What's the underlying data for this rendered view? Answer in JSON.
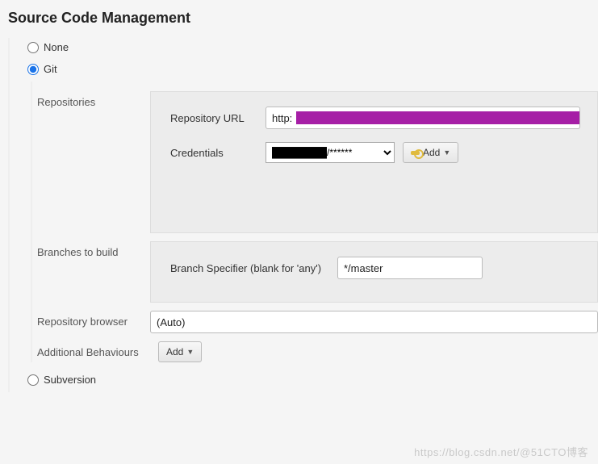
{
  "section_title": "Source Code Management",
  "scm_options": {
    "none": "None",
    "git": "Git",
    "subversion": "Subversion"
  },
  "git": {
    "repositories_label": "Repositories",
    "repo_url_label": "Repository URL",
    "repo_url_prefix": "http:",
    "repo_url_redacted": true,
    "credentials_label": "Credentials",
    "credentials_selected": "████████/******",
    "add_button": "Add",
    "branches_label": "Branches to build",
    "branch_specifier_label": "Branch Specifier (blank for 'any')",
    "branch_specifier_value": "*/master",
    "repo_browser_label": "Repository browser",
    "repo_browser_value": "(Auto)",
    "additional_behaviours_label": "Additional Behaviours",
    "additional_behaviours_button": "Add"
  },
  "watermark": "https://blog.csdn.net/@51CTO博客"
}
